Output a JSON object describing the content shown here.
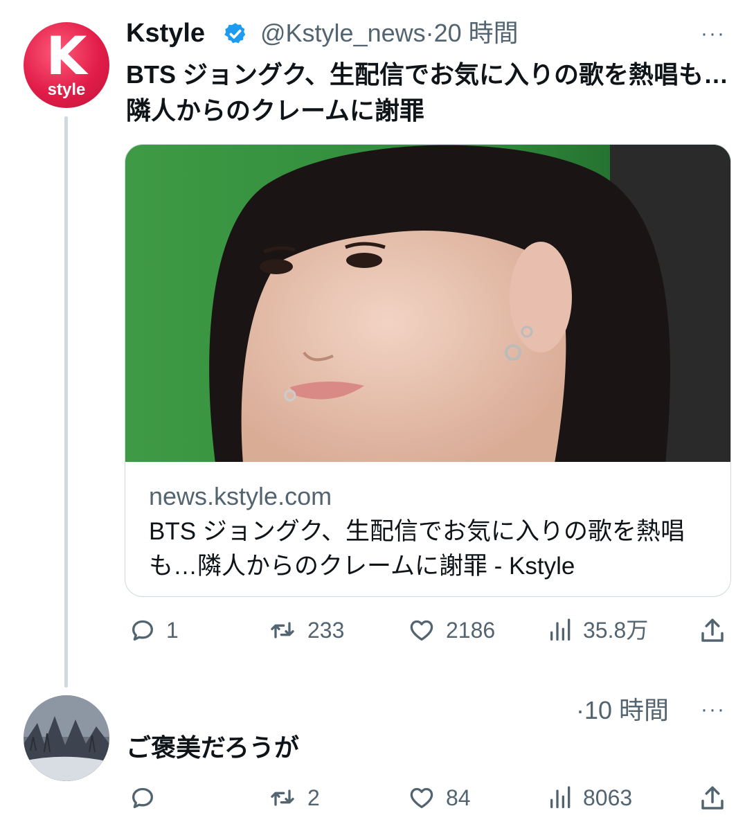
{
  "tweet": {
    "avatar": {
      "letter": "K",
      "sub": "style",
      "color": "#e11d48"
    },
    "name": "Kstyle",
    "handle": "@Kstyle_news",
    "time": "·20 時間",
    "more": "···",
    "text": "BTS ジョングク、生配信でお気に入りの歌を熱唱も…隣人からのクレームに謝罪",
    "card": {
      "domain": "news.kstyle.com",
      "title": "BTS ジョングク、生配信でお気に入りの歌を熱唱も…隣人からのクレームに謝罪 - Kstyle"
    },
    "actions": {
      "replies": "1",
      "retweets": "233",
      "likes": "2186",
      "views": "35.8万"
    }
  },
  "reply": {
    "time": "·10 時間",
    "more": "···",
    "text": "ご褒美だろうが",
    "actions": {
      "replies": "",
      "retweets": "2",
      "likes": "84",
      "views": "8063"
    }
  },
  "icons": {
    "verified": "verified-badge-icon",
    "reply": "reply-icon",
    "retweet": "retweet-icon",
    "like": "heart-icon",
    "views": "views-icon",
    "share": "share-icon"
  },
  "colors": {
    "verified": "#1d9bf0",
    "secondary_text": "#536471",
    "thread_line": "#cfd9de"
  }
}
